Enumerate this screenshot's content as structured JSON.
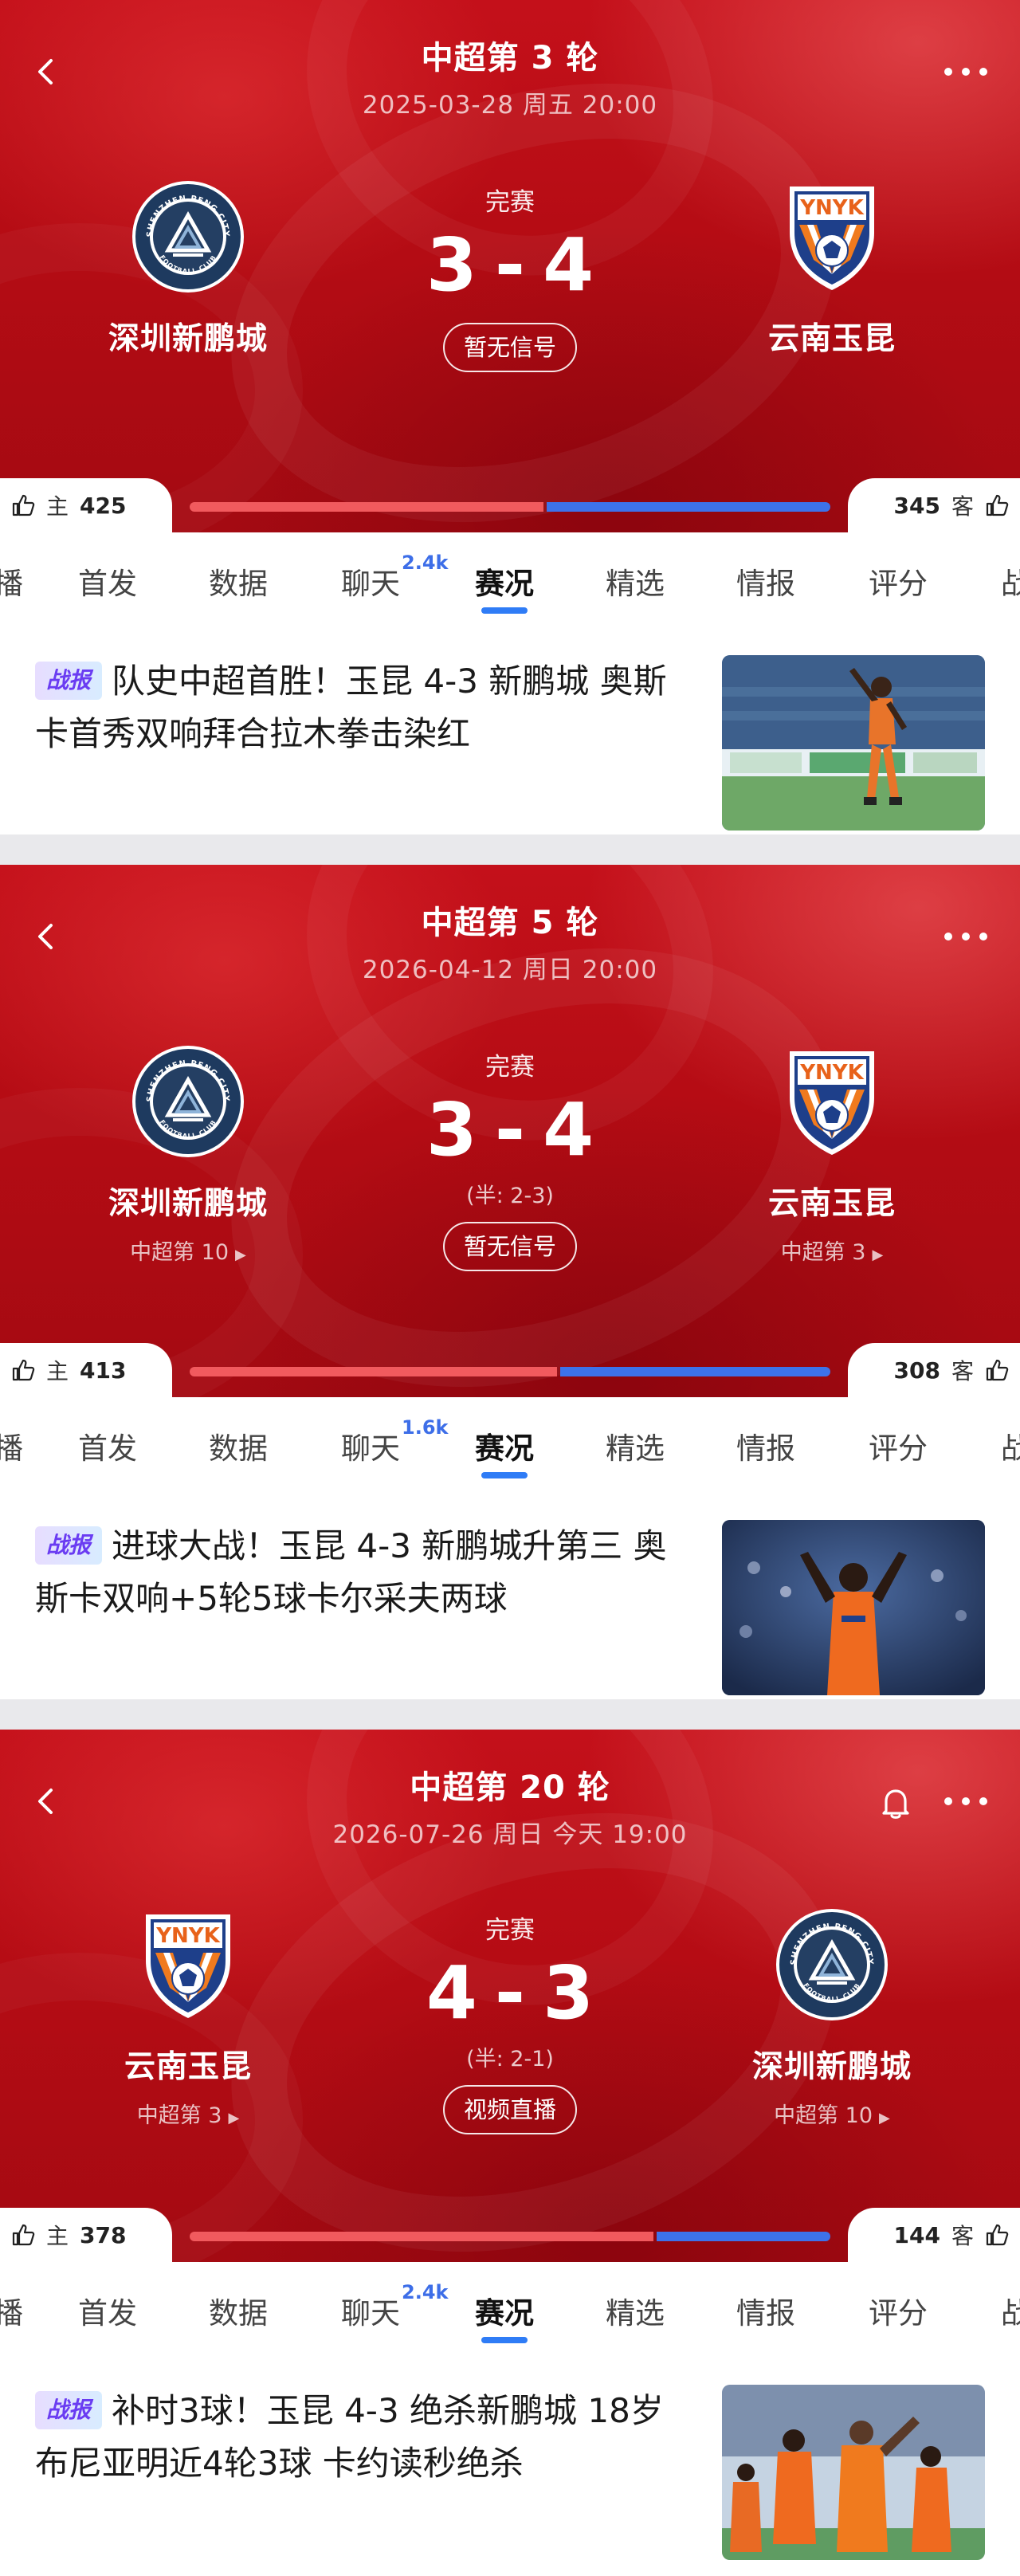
{
  "matches": [
    {
      "round": "中超第 3 轮",
      "datetime": "2025-03-28 周五 20:00",
      "status": "完赛",
      "score_left": "3",
      "score_right": "4",
      "half": "",
      "signal": "暂无信号",
      "left_team": {
        "name": "深圳新鹏城",
        "rank": "",
        "club": "shenzhen"
      },
      "right_team": {
        "name": "云南玉昆",
        "rank": "",
        "club": "ynyk"
      },
      "vote": {
        "home_label": "主",
        "home_count": "425",
        "away_label": "客",
        "away_count": "345",
        "home_fraction": 0.552
      },
      "show_bell": false,
      "tabs": [
        {
          "label": "播",
          "sup": ""
        },
        {
          "label": "首发",
          "sup": ""
        },
        {
          "label": "数据",
          "sup": ""
        },
        {
          "label": "聊天",
          "sup": "2.4k"
        },
        {
          "label": "赛况",
          "sup": "",
          "active": true
        },
        {
          "label": "精选",
          "sup": ""
        },
        {
          "label": "情报",
          "sup": ""
        },
        {
          "label": "评分",
          "sup": ""
        },
        {
          "label": "战",
          "sup": ""
        }
      ],
      "news": {
        "badge": "战报",
        "title": "队史中超首胜！玉昆 4-3 新鹏城 奥斯卡首秀双响拜合拉木拳击染红",
        "thumb": "player-celebrating-on-pitch"
      }
    },
    {
      "round": "中超第 5 轮",
      "datetime": "2026-04-12 周日 20:00",
      "status": "完赛",
      "score_left": "3",
      "score_right": "4",
      "half": "(半: 2-3)",
      "signal": "暂无信号",
      "left_team": {
        "name": "深圳新鹏城",
        "rank": "中超第 10",
        "club": "shenzhen"
      },
      "right_team": {
        "name": "云南玉昆",
        "rank": "中超第 3",
        "club": "ynyk"
      },
      "vote": {
        "home_label": "主",
        "home_count": "413",
        "away_label": "客",
        "away_count": "308",
        "home_fraction": 0.573
      },
      "show_bell": false,
      "tabs": [
        {
          "label": "播",
          "sup": ""
        },
        {
          "label": "首发",
          "sup": ""
        },
        {
          "label": "数据",
          "sup": ""
        },
        {
          "label": "聊天",
          "sup": "1.6k"
        },
        {
          "label": "赛况",
          "sup": "",
          "active": true
        },
        {
          "label": "精选",
          "sup": ""
        },
        {
          "label": "情报",
          "sup": ""
        },
        {
          "label": "评分",
          "sup": ""
        },
        {
          "label": "战",
          "sup": ""
        }
      ],
      "news": {
        "badge": "战报",
        "title": "进球大战！玉昆 4-3 新鹏城升第三 奥斯卡双响+5轮5球卡尔采夫两球",
        "thumb": "player-arms-raised"
      }
    },
    {
      "round": "中超第 20 轮",
      "datetime": "2026-07-26 周日 今天 19:00",
      "status": "完赛",
      "score_left": "4",
      "score_right": "3",
      "half": "(半: 2-1)",
      "signal": "视频直播",
      "left_team": {
        "name": "云南玉昆",
        "rank": "中超第 3",
        "club": "ynyk"
      },
      "right_team": {
        "name": "深圳新鹏城",
        "rank": "中超第 10",
        "club": "shenzhen"
      },
      "vote": {
        "home_label": "主",
        "home_count": "378",
        "away_label": "客",
        "away_count": "144",
        "home_fraction": 0.724
      },
      "show_bell": true,
      "tabs": [
        {
          "label": "播",
          "sup": ""
        },
        {
          "label": "首发",
          "sup": ""
        },
        {
          "label": "数据",
          "sup": ""
        },
        {
          "label": "聊天",
          "sup": "2.4k"
        },
        {
          "label": "赛况",
          "sup": "",
          "active": true
        },
        {
          "label": "精选",
          "sup": ""
        },
        {
          "label": "情报",
          "sup": ""
        },
        {
          "label": "评分",
          "sup": ""
        },
        {
          "label": "战",
          "sup": ""
        }
      ],
      "news": {
        "badge": "战报",
        "title": "补时3球！玉昆 4-3 绝杀新鹏城 18岁布尼亚明近4轮3球 卡约读秒绝杀",
        "thumb": "players-celebrating-group"
      }
    }
  ],
  "logos": {
    "shenzhen": {
      "ring_text": "SHENZHEN PENG CITY",
      "bottom_text": "FOOTBALL CLUB"
    },
    "ynyk": {
      "text": "YNYK"
    }
  },
  "colors": {
    "hero_red": "#b50c14",
    "home_bar": "#f15a5e",
    "away_bar": "#3d72ea",
    "tab_underline": "#2f7cf6",
    "chat_count": "#3d6ee8"
  },
  "icons": {
    "back": "chevron-left-icon",
    "more": "more-dots-icon",
    "bell": "bell-icon",
    "thumb": "thumbs-up-icon"
  }
}
